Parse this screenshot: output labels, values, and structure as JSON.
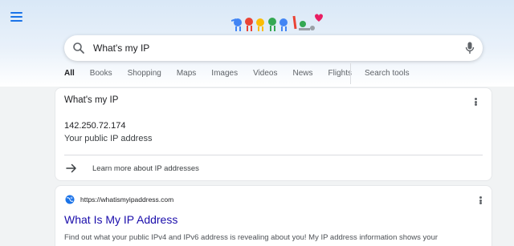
{
  "search": {
    "query": "What's my IP"
  },
  "tabs": [
    {
      "label": "All",
      "active": true
    },
    {
      "label": "Books"
    },
    {
      "label": "Shopping"
    },
    {
      "label": "Maps"
    },
    {
      "label": "Images"
    },
    {
      "label": "Videos"
    },
    {
      "label": "News"
    },
    {
      "label": "Flights"
    }
  ],
  "tools_label": "Search tools",
  "ip_card": {
    "title": "What's my IP",
    "ip": "142.250.72.174",
    "subtitle": "Your public IP address",
    "learn_more": "Learn more about IP addresses"
  },
  "result": {
    "url": "https://whatismyipaddress.com",
    "title": "What Is My IP Address",
    "snippet": "Find out what your public IPv4 and IPv6 address is revealing about you! My IP address information shows your"
  },
  "colors": {
    "accent": "#1a73e8",
    "link": "#1a0dab"
  }
}
